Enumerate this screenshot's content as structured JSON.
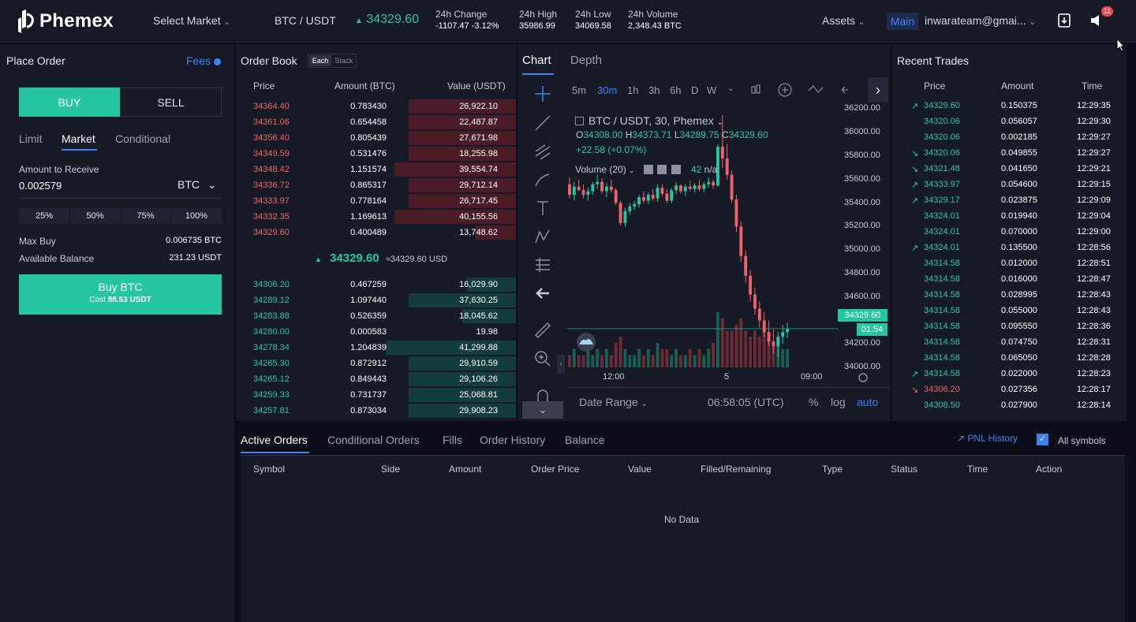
{
  "header": {
    "logo_text": "Phemex",
    "select_market": "Select Market",
    "pair": "BTC / USDT",
    "last_price": "34329.60",
    "change_label": "24h Change",
    "change_value": "-1107.47 -3.12%",
    "high_label": "24h High",
    "high_value": "35986.99",
    "low_label": "24h Low",
    "low_value": "34069.58",
    "volume_label": "24h Volume",
    "volume_value": "2,348.43 BTC",
    "assets": "Assets",
    "account_tag": "Main",
    "email": "inwarateam@gmai...",
    "notif_count": "11"
  },
  "place_order": {
    "title": "Place Order",
    "fees": "Fees",
    "buy": "BUY",
    "sell": "SELL",
    "tabs": [
      "Limit",
      "Market",
      "Conditional"
    ],
    "amount_label": "Amount to Receive",
    "amount_value": "0.002579",
    "currency": "BTC",
    "percents": [
      "25%",
      "50%",
      "75%",
      "100%"
    ],
    "max_buy_label": "Max Buy",
    "max_buy_value": "0.006735 BTC",
    "avail_label": "Available Balance",
    "avail_value": "231.23 USDT",
    "submit": "Buy BTC",
    "cost_label": "Cost",
    "cost_value": "88.53 USDT"
  },
  "order_book": {
    "title": "Order Book",
    "mode_each": "Each",
    "mode_stack": "Stack",
    "headers": [
      "Price",
      "Amount (BTC)",
      "Value (USDT)"
    ],
    "asks": [
      {
        "price": "34364.40",
        "amount": "0.783430",
        "value": "26,922.10",
        "depth": 0.62
      },
      {
        "price": "34361.06",
        "amount": "0.654458",
        "value": "22,487.87",
        "depth": 0.62
      },
      {
        "price": "34356.40",
        "amount": "0.805439",
        "value": "27,671.98",
        "depth": 0.62
      },
      {
        "price": "34349.59",
        "amount": "0.531476",
        "value": "18,255.98",
        "depth": 0.62
      },
      {
        "price": "34348.42",
        "amount": "1.151574",
        "value": "39,554.74",
        "depth": 0.7
      },
      {
        "price": "34336.72",
        "amount": "0.865317",
        "value": "29,712.14",
        "depth": 0.62
      },
      {
        "price": "34333.97",
        "amount": "0.778164",
        "value": "26,717.45",
        "depth": 0.62
      },
      {
        "price": "34332.35",
        "amount": "1.169613",
        "value": "40,155.56",
        "depth": 0.7
      },
      {
        "price": "34329.60",
        "amount": "0.400489",
        "value": "13,748.62",
        "depth": 0.23
      }
    ],
    "mid_price": "34329.60",
    "mid_usd": "≈34329.60 USD",
    "bids": [
      {
        "price": "34306.20",
        "amount": "0.467259",
        "value": "16,029.90",
        "depth": 0.28
      },
      {
        "price": "34289.12",
        "amount": "1.097440",
        "value": "37,630.25",
        "depth": 0.62
      },
      {
        "price": "34283.88",
        "amount": "0.526359",
        "value": "18,045.62",
        "depth": 0.31
      },
      {
        "price": "34280.00",
        "amount": "0.000583",
        "value": "19.98",
        "depth": 0.0
      },
      {
        "price": "34278.34",
        "amount": "1.204839",
        "value": "41,299.88",
        "depth": 0.75
      },
      {
        "price": "34265.30",
        "amount": "0.872912",
        "value": "29,910.59",
        "depth": 0.62
      },
      {
        "price": "34265.12",
        "amount": "0.849443",
        "value": "29,106.26",
        "depth": 0.62
      },
      {
        "price": "34259.33",
        "amount": "0.731737",
        "value": "25,068.81",
        "depth": 0.62
      },
      {
        "price": "34257.81",
        "amount": "0.873034",
        "value": "29,908.23",
        "depth": 0.62
      }
    ]
  },
  "chart": {
    "tab_chart": "Chart",
    "tab_depth": "Depth",
    "timeframes": [
      "5m",
      "30m",
      "1h",
      "3h",
      "6h",
      "D",
      "W"
    ],
    "symbol_line": "BTC / USDT, 30, Phemex",
    "o_label": "O",
    "o_value": "34308.00",
    "h_label": "H",
    "h_value": "34373.71",
    "l_label": "L",
    "l_value": "34289.75",
    "c_label": "C",
    "c_value": "34329.60",
    "change": "+22.58 (+0.07%)",
    "volume_label": "Volume (20)",
    "volume_value": "42",
    "volume_na": "n/a",
    "price_ticks": [
      "36200.00",
      "36000.00",
      "35800.00",
      "35600.00",
      "35400.00",
      "35200.00",
      "35000.00",
      "34800.00",
      "34600.00",
      "34400.00",
      "34200.00",
      "34000.00"
    ],
    "time_ticks": [
      "12:00",
      "5",
      "09:00"
    ],
    "last_price_tag": "34329.60",
    "countdown": "01:54",
    "date_range": "Date Range",
    "clock": "06:58:05 (UTC)",
    "opt_pct": "%",
    "opt_log": "log",
    "opt_auto": "auto",
    "colors": {
      "up": "#26c6a0",
      "down": "#f0616d"
    }
  },
  "chart_data": {
    "type": "candlestick",
    "ylim": [
      34000,
      36250
    ],
    "candles": [
      [
        35560,
        35620,
        35440,
        35470
      ],
      [
        35470,
        35580,
        35420,
        35540
      ],
      [
        35540,
        35600,
        35500,
        35510
      ],
      [
        35510,
        35560,
        35440,
        35470
      ],
      [
        35470,
        35530,
        35420,
        35500
      ],
      [
        35500,
        35580,
        35470,
        35560
      ],
      [
        35560,
        35640,
        35520,
        35580
      ],
      [
        35580,
        35610,
        35480,
        35500
      ],
      [
        35500,
        35570,
        35450,
        35540
      ],
      [
        35540,
        35600,
        35490,
        35510
      ],
      [
        35510,
        35530,
        35380,
        35400
      ],
      [
        35400,
        35420,
        35210,
        35230
      ],
      [
        35230,
        35360,
        35200,
        35330
      ],
      [
        35330,
        35400,
        35300,
        35370
      ],
      [
        35370,
        35420,
        35340,
        35390
      ],
      [
        35390,
        35470,
        35360,
        35450
      ],
      [
        35450,
        35500,
        35400,
        35420
      ],
      [
        35420,
        35490,
        35390,
        35470
      ],
      [
        35470,
        35520,
        35420,
        35440
      ],
      [
        35440,
        35560,
        35410,
        35530
      ],
      [
        35530,
        35560,
        35460,
        35480
      ],
      [
        35480,
        35520,
        35400,
        35420
      ],
      [
        35420,
        35530,
        35400,
        35510
      ],
      [
        35510,
        35580,
        35480,
        35550
      ],
      [
        35550,
        35560,
        35480,
        35500
      ],
      [
        35500,
        35560,
        35460,
        35540
      ],
      [
        35540,
        35590,
        35500,
        35520
      ],
      [
        35520,
        35570,
        35490,
        35550
      ],
      [
        35550,
        35600,
        35500,
        35520
      ],
      [
        35520,
        35580,
        35490,
        35560
      ],
      [
        35560,
        35620,
        35530,
        35580
      ],
      [
        35580,
        35600,
        35520,
        35550
      ],
      [
        35550,
        35900,
        35540,
        35880
      ],
      [
        35880,
        36150,
        35700,
        35780
      ],
      [
        35780,
        35900,
        35600,
        35640
      ],
      [
        35640,
        35680,
        35400,
        35430
      ],
      [
        35430,
        35470,
        35150,
        35200
      ],
      [
        35200,
        35250,
        34900,
        34950
      ],
      [
        34950,
        35000,
        34720,
        34780
      ],
      [
        34780,
        34830,
        34560,
        34620
      ],
      [
        34620,
        34680,
        34450,
        34500
      ],
      [
        34500,
        34560,
        34340,
        34400
      ],
      [
        34400,
        34470,
        34260,
        34300
      ],
      [
        34300,
        34400,
        34180,
        34220
      ],
      [
        34220,
        34320,
        34120,
        34180
      ],
      [
        34180,
        34300,
        34090,
        34260
      ],
      [
        34260,
        34360,
        34200,
        34300
      ],
      [
        34300,
        34380,
        34250,
        34330
      ]
    ],
    "volumes": [
      2,
      3,
      2,
      2,
      3,
      2,
      3,
      2,
      3,
      2,
      4,
      5,
      3,
      2,
      2,
      3,
      2,
      3,
      2,
      4,
      3,
      3,
      2,
      3,
      2,
      2,
      3,
      2,
      3,
      2,
      3,
      4,
      9,
      8,
      6,
      6,
      7,
      8,
      6,
      5,
      6,
      5,
      6,
      5,
      4,
      5,
      3,
      3
    ]
  },
  "recent_trades": {
    "title": "Recent Trades",
    "headers": [
      "Price",
      "Amount",
      "Time"
    ],
    "rows": [
      {
        "price": "34329.60",
        "amount": "0.150375",
        "time": "12:29:35",
        "side": "buy",
        "arrow": "up"
      },
      {
        "price": "34320.06",
        "amount": "0.056057",
        "time": "12:29:30",
        "side": "buy",
        "arrow": ""
      },
      {
        "price": "34320.06",
        "amount": "0.002185",
        "time": "12:29:27",
        "side": "buy",
        "arrow": ""
      },
      {
        "price": "34320.06",
        "amount": "0.049855",
        "time": "12:29:27",
        "side": "buy",
        "arrow": "down"
      },
      {
        "price": "34321.48",
        "amount": "0.041650",
        "time": "12:29:21",
        "side": "buy",
        "arrow": "down"
      },
      {
        "price": "34333.97",
        "amount": "0.054600",
        "time": "12:29:15",
        "side": "buy",
        "arrow": "up"
      },
      {
        "price": "34329.17",
        "amount": "0.023875",
        "time": "12:29:09",
        "side": "buy",
        "arrow": "up"
      },
      {
        "price": "34324.01",
        "amount": "0.019940",
        "time": "12:29:04",
        "side": "buy",
        "arrow": ""
      },
      {
        "price": "34324.01",
        "amount": "0.070000",
        "time": "12:29:00",
        "side": "buy",
        "arrow": ""
      },
      {
        "price": "34324.01",
        "amount": "0.135500",
        "time": "12:28:56",
        "side": "buy",
        "arrow": "up"
      },
      {
        "price": "34314.58",
        "amount": "0.012000",
        "time": "12:28:51",
        "side": "buy",
        "arrow": ""
      },
      {
        "price": "34314.58",
        "amount": "0.016000",
        "time": "12:28:47",
        "side": "buy",
        "arrow": ""
      },
      {
        "price": "34314.58",
        "amount": "0.028995",
        "time": "12:28:43",
        "side": "buy",
        "arrow": ""
      },
      {
        "price": "34314.58",
        "amount": "0.055000",
        "time": "12:28:43",
        "side": "buy",
        "arrow": ""
      },
      {
        "price": "34314.58",
        "amount": "0.095550",
        "time": "12:28:36",
        "side": "buy",
        "arrow": ""
      },
      {
        "price": "34314.58",
        "amount": "0.074750",
        "time": "12:28:31",
        "side": "buy",
        "arrow": ""
      },
      {
        "price": "34314.58",
        "amount": "0.065050",
        "time": "12:28:28",
        "side": "buy",
        "arrow": ""
      },
      {
        "price": "34314.58",
        "amount": "0.022000",
        "time": "12:28:23",
        "side": "buy",
        "arrow": "up"
      },
      {
        "price": "34306.20",
        "amount": "0.027356",
        "time": "12:28:17",
        "side": "sell",
        "arrow": "down"
      },
      {
        "price": "34308.50",
        "amount": "0.027900",
        "time": "12:28:14",
        "side": "buy",
        "arrow": ""
      }
    ]
  },
  "orders": {
    "tabs": [
      "Active Orders",
      "Conditional Orders",
      "Fills",
      "Order History",
      "Balance"
    ],
    "pnl_history": "PNL History",
    "all_symbols": "All symbols",
    "columns": [
      "Symbol",
      "Side",
      "Amount",
      "Order Price",
      "Value",
      "Filled/Remaining",
      "Type",
      "Status",
      "Time",
      "Action"
    ],
    "empty": "No Data"
  }
}
